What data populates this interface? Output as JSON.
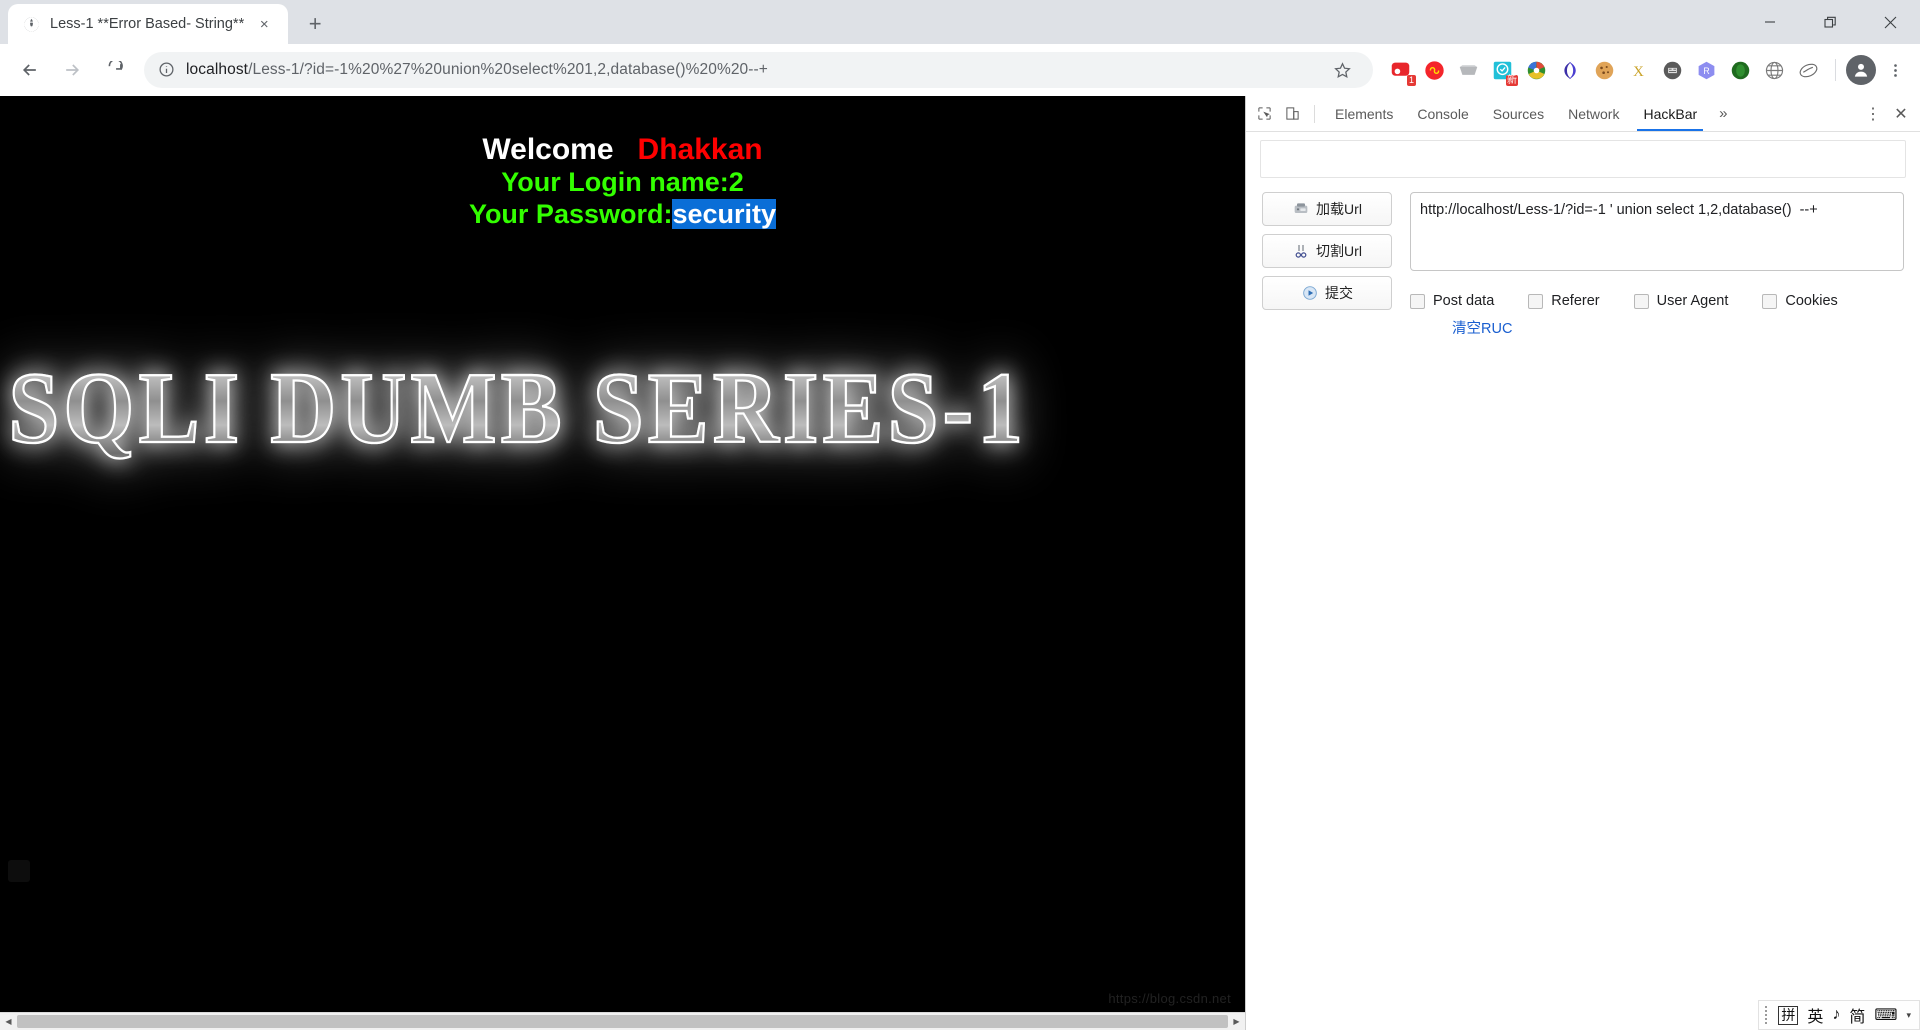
{
  "window": {
    "minimize_label": "Minimize",
    "restore_label": "Restore",
    "close_label": "Close"
  },
  "tab": {
    "title": "Less-1 **Error Based- String**",
    "close_label": "×",
    "new_tab_label": "+"
  },
  "toolbar": {
    "back_label": "Back",
    "forward_label": "Forward",
    "reload_label": "Reload",
    "bookmark_label": "Bookmark this tab",
    "profile_label": "Profile",
    "menu_label": "Customize and control Google Chrome"
  },
  "omnibox": {
    "url_host": "localhost",
    "url_path": "/Less-1/?id=-1%20%27%20union%20select%201,2,database()%20%20--+",
    "full_url": "localhost/Less-1/?id=-1%20%27%20union%20select%201,2,database()%20%20--+",
    "site_info_label": "View site information"
  },
  "extensions": [
    {
      "name": "extension-proxy-switcher",
      "badge": "1"
    },
    {
      "name": "extension-infinity",
      "badge": ""
    },
    {
      "name": "extension-wappalyzer",
      "badge": ""
    },
    {
      "name": "extension-xinbaidu",
      "badge": "新"
    },
    {
      "name": "extension-internet-download-manager",
      "badge": ""
    },
    {
      "name": "extension-sogou",
      "badge": ""
    },
    {
      "name": "extension-editthiscookie",
      "badge": ""
    },
    {
      "name": "extension-xswitch",
      "badge": ""
    },
    {
      "name": "extension-tampermonkey",
      "badge": ""
    },
    {
      "name": "extension-react-devtools",
      "badge": ""
    },
    {
      "name": "extension-firebug",
      "badge": ""
    },
    {
      "name": "extension-globe-translate",
      "badge": ""
    },
    {
      "name": "extension-hackbar",
      "badge": ""
    }
  ],
  "page": {
    "welcome_label": "Welcome",
    "user_label": "Dhakkan",
    "login_name_line": "Your Login name:2",
    "password_prefix": "Your Password:",
    "password_value": "security",
    "banner_text": "SQLI DUMB SERIES-1",
    "watermark": "https://blog.csdn.net"
  },
  "devtools": {
    "inspect_label": "Inspect element",
    "device_toolbar_label": "Toggle device toolbar",
    "tabs": [
      {
        "label": "Elements",
        "active": false
      },
      {
        "label": "Console",
        "active": false
      },
      {
        "label": "Sources",
        "active": false
      },
      {
        "label": "Network",
        "active": false
      },
      {
        "label": "HackBar",
        "active": true
      }
    ],
    "more_tabs_label": "»",
    "settings_label": "⋮",
    "close_label": "✕"
  },
  "hackbar": {
    "buttons": [
      {
        "label": "加载Url",
        "icon": "load-url-icon"
      },
      {
        "label": "切割Url",
        "icon": "split-url-icon"
      },
      {
        "label": "提交",
        "icon": "execute-icon"
      }
    ],
    "url_value": "http://localhost/Less-1/?id=-1 ' union select 1,2,database()  --+",
    "url_placeholder": "",
    "checkboxes": [
      {
        "label": "Post data",
        "checked": false
      },
      {
        "label": "Referer",
        "checked": false
      },
      {
        "label": "User Agent",
        "checked": false
      },
      {
        "label": "Cookies",
        "checked": false
      }
    ],
    "clear_link": "清空RUC"
  },
  "ime": {
    "mode_key": "拼",
    "lang": "英",
    "music": "♪",
    "script": "简",
    "keyboard": "⌨",
    "caret": "▾"
  },
  "colors": {
    "accent": "#1a73e8",
    "welcome": "#ffffff",
    "user": "#ff0000",
    "login": "#33ff00",
    "selection": "#0a6ed7",
    "chrome_bg": "#dee1e6"
  }
}
